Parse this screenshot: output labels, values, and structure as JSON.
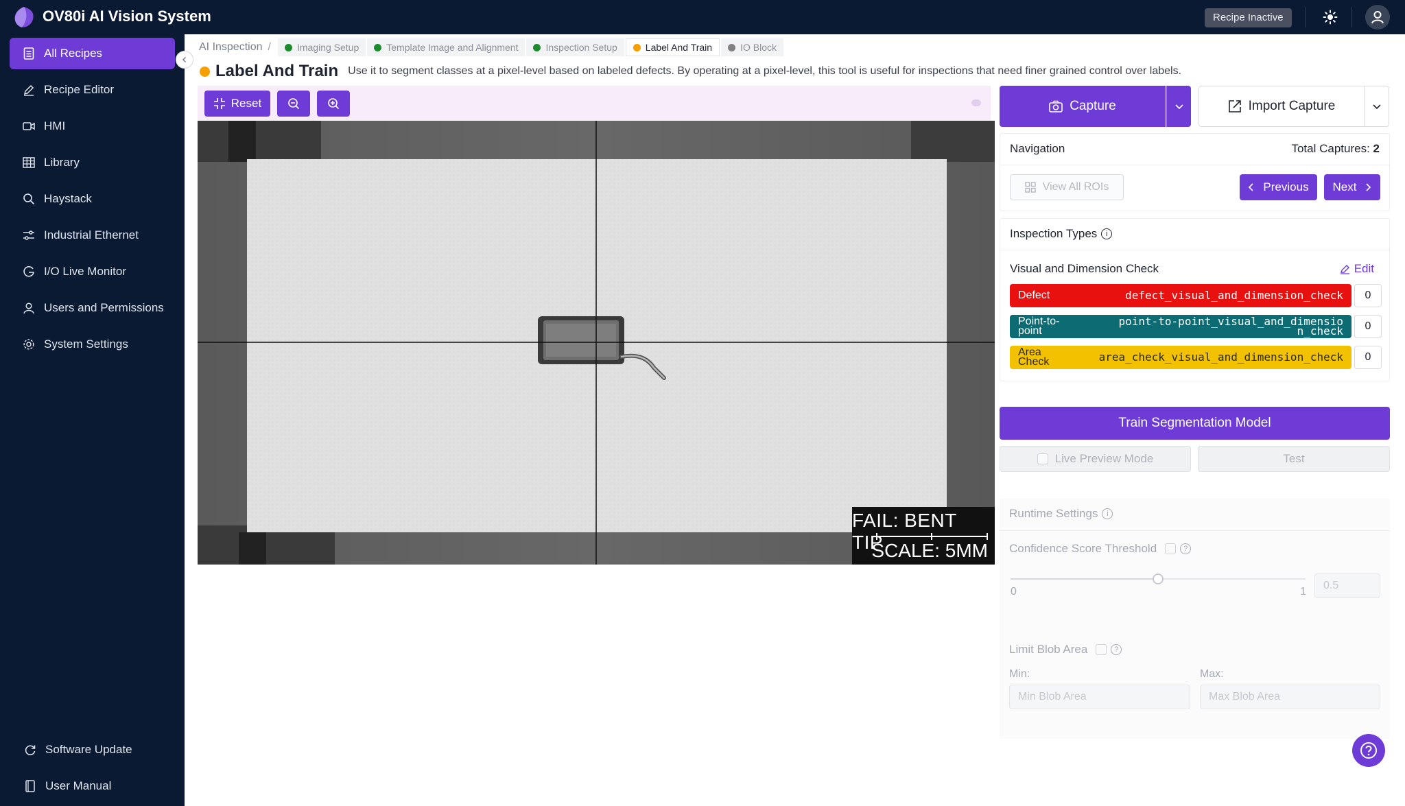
{
  "app": {
    "title": "OV80i AI Vision System",
    "status": "Recipe Inactive"
  },
  "sidebar": {
    "items": [
      {
        "label": "All Recipes",
        "icon": "document-icon",
        "active": true
      },
      {
        "label": "Recipe Editor",
        "icon": "pencil-icon"
      },
      {
        "label": "HMI",
        "icon": "video-icon"
      },
      {
        "label": "Library",
        "icon": "grid-icon"
      },
      {
        "label": "Haystack",
        "icon": "search-icon"
      },
      {
        "label": "Industrial Ethernet",
        "icon": "ethernet-icon"
      },
      {
        "label": "I/O Live Monitor",
        "icon": "gauge-icon"
      },
      {
        "label": "Users and Permissions",
        "icon": "user-icon"
      },
      {
        "label": "System Settings",
        "icon": "gear-icon"
      }
    ],
    "bottom": [
      {
        "label": "Software Update",
        "icon": "refresh-icon"
      },
      {
        "label": "User Manual",
        "icon": "book-icon"
      }
    ]
  },
  "breadcrumb": {
    "root": "AI Inspection",
    "separator": "/",
    "tabs": [
      {
        "label": "Imaging Setup",
        "status": "complete",
        "color": "#1e8a2e"
      },
      {
        "label": "Template Image and Alignment",
        "status": "complete",
        "color": "#1e8a2e"
      },
      {
        "label": "Inspection Setup",
        "status": "complete",
        "color": "#1e8a2e"
      },
      {
        "label": "Label And Train",
        "status": "current",
        "color": "#f5a000"
      },
      {
        "label": "IO Block",
        "status": "pending",
        "color": "#808080"
      }
    ]
  },
  "page": {
    "title": "Label And Train",
    "description": "Use it to segment classes at a pixel-level based on labeled defects. By operating at a pixel-level, this tool is useful for inspections that need finer grained control over labels."
  },
  "toolbar": {
    "reset_label": "Reset",
    "zoom_out_icon": "zoom-out-icon",
    "zoom_in_icon": "zoom-in-icon"
  },
  "viewer": {
    "overlay_fail": "FAIL: BENT TIP",
    "overlay_scale": "SCALE: 5MM"
  },
  "capture": {
    "capture_label": "Capture",
    "import_label": "Import Capture"
  },
  "navigation": {
    "title": "Navigation",
    "total_label": "Total Captures:",
    "total_value": "2",
    "view_all_label": "View All ROIs",
    "previous_label": "Previous",
    "next_label": "Next"
  },
  "inspection_types": {
    "title": "Inspection Types",
    "group_name": "Visual and Dimension Check",
    "edit_label": "Edit",
    "rows": [
      {
        "name": "Defect",
        "key": "defect_visual_and_dimension_check",
        "count": "0",
        "color": "#e8110f",
        "text_color": "#ffffff"
      },
      {
        "name": "Point-to-point",
        "key": "point-to-point_visual_and_dimension_check",
        "count": "0",
        "color": "#0d6b73",
        "text_color": "#ffffff"
      },
      {
        "name": "Area Check",
        "key": "area_check_visual_and_dimension_check",
        "count": "0",
        "color": "#f2c200",
        "text_color": "#2a2a2a"
      }
    ]
  },
  "actions": {
    "train_label": "Train Segmentation Model",
    "live_preview_label": "Live Preview Mode",
    "test_label": "Test"
  },
  "runtime": {
    "title": "Runtime Settings",
    "confidence_label": "Confidence Score Threshold",
    "slider_min": "0",
    "slider_max": "1",
    "slider_value": 0.5,
    "slider_input": "0.5",
    "blob_label": "Limit Blob Area",
    "min_label": "Min:",
    "max_label": "Max:",
    "min_placeholder": "Min Blob Area",
    "max_placeholder": "Max Blob Area"
  }
}
